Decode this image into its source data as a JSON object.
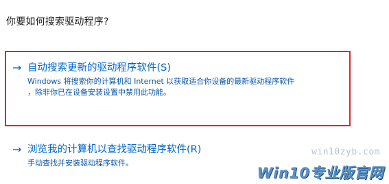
{
  "question": "你要如何搜索驱动程序?",
  "options": [
    {
      "arrow": "→",
      "title": "自动搜索更新的驱动程序软件(S)",
      "desc_line1": "Windows 将搜索你的计算机和 Internet 以获取适合你设备的最新驱动程序软件",
      "desc_line2": "，除非你已在设备安装设置中禁用此功能。"
    },
    {
      "arrow": "→",
      "title": "浏览我的计算机以查找驱动程序软件(R)",
      "desc_line1": "手动查找并安装驱动程序软件。"
    }
  ],
  "watermark": {
    "url": "win10zyb.com",
    "logo": "Win10专业版官网"
  },
  "colors": {
    "link": "#0066cc",
    "highlight": "#e0242b"
  }
}
